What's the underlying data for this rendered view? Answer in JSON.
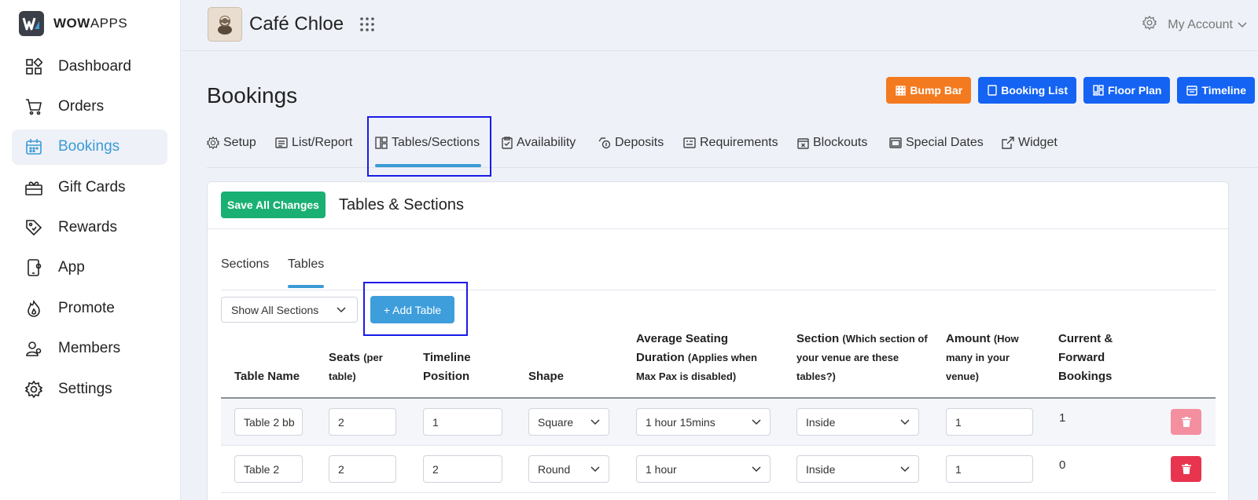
{
  "brand": {
    "bold": "WOW",
    "light": "APPS"
  },
  "sidebar": {
    "items": [
      {
        "label": "Dashboard",
        "icon": "dashboard-icon"
      },
      {
        "label": "Orders",
        "icon": "cart-icon"
      },
      {
        "label": "Bookings",
        "icon": "calendar-icon",
        "active": true
      },
      {
        "label": "Gift Cards",
        "icon": "gift-card-icon"
      },
      {
        "label": "Rewards",
        "icon": "tag-icon"
      },
      {
        "label": "App",
        "icon": "phone-icon"
      },
      {
        "label": "Promote",
        "icon": "flame-icon"
      },
      {
        "label": "Members",
        "icon": "members-icon"
      },
      {
        "label": "Settings",
        "icon": "gear-icon"
      }
    ]
  },
  "topbar": {
    "venue_name": "Café Chloe",
    "account_label": "My Account"
  },
  "page": {
    "title": "Bookings",
    "header_buttons": [
      {
        "label": "Bump Bar",
        "color": "#f47a20"
      },
      {
        "label": "Booking List",
        "color": "#1463f3"
      },
      {
        "label": "Floor Plan",
        "color": "#1463f3"
      },
      {
        "label": "Timeline",
        "color": "#1463f3"
      }
    ],
    "tabs": [
      {
        "label": "Setup"
      },
      {
        "label": "List/Report"
      },
      {
        "label": "Tables/Sections",
        "active": true
      },
      {
        "label": "Availability"
      },
      {
        "label": "Deposits"
      },
      {
        "label": "Requirements"
      },
      {
        "label": "Blockouts"
      },
      {
        "label": "Special Dates"
      },
      {
        "label": "Widget"
      }
    ]
  },
  "card": {
    "save_label": "Save All Changes",
    "title": "Tables & Sections",
    "inner_tabs": [
      {
        "label": "Sections"
      },
      {
        "label": "Tables",
        "active": true
      }
    ],
    "section_filter": "Show All Sections",
    "add_table_label": "+ Add Table",
    "columns": {
      "name": "Table Name",
      "seats": "Seats",
      "seats_note": "(per table)",
      "timeline": "Timeline Position",
      "shape": "Shape",
      "duration": "Average Seating Duration",
      "duration_note": "(Applies when Max Pax is disabled)",
      "section": "Section",
      "section_note": "(Which section of your venue are these tables?)",
      "amount": "Amount",
      "amount_note": "(How many in your venue)",
      "bookings": "Current & Forward Bookings"
    },
    "rows": [
      {
        "name": "Table 2 bb",
        "seats": "2",
        "timeline": "1",
        "shape": "Square",
        "duration": "1 hour 15mins",
        "section": "Inside",
        "amount": "1",
        "bookings": "1"
      },
      {
        "name": "Table 2",
        "seats": "2",
        "timeline": "2",
        "shape": "Round",
        "duration": "1 hour",
        "section": "Inside",
        "amount": "1",
        "bookings": "0"
      }
    ]
  },
  "colors": {
    "accent": "#3a9bd5",
    "save": "#1ab073",
    "highlight": "#1a1ae8",
    "delete": "#e9344f"
  }
}
